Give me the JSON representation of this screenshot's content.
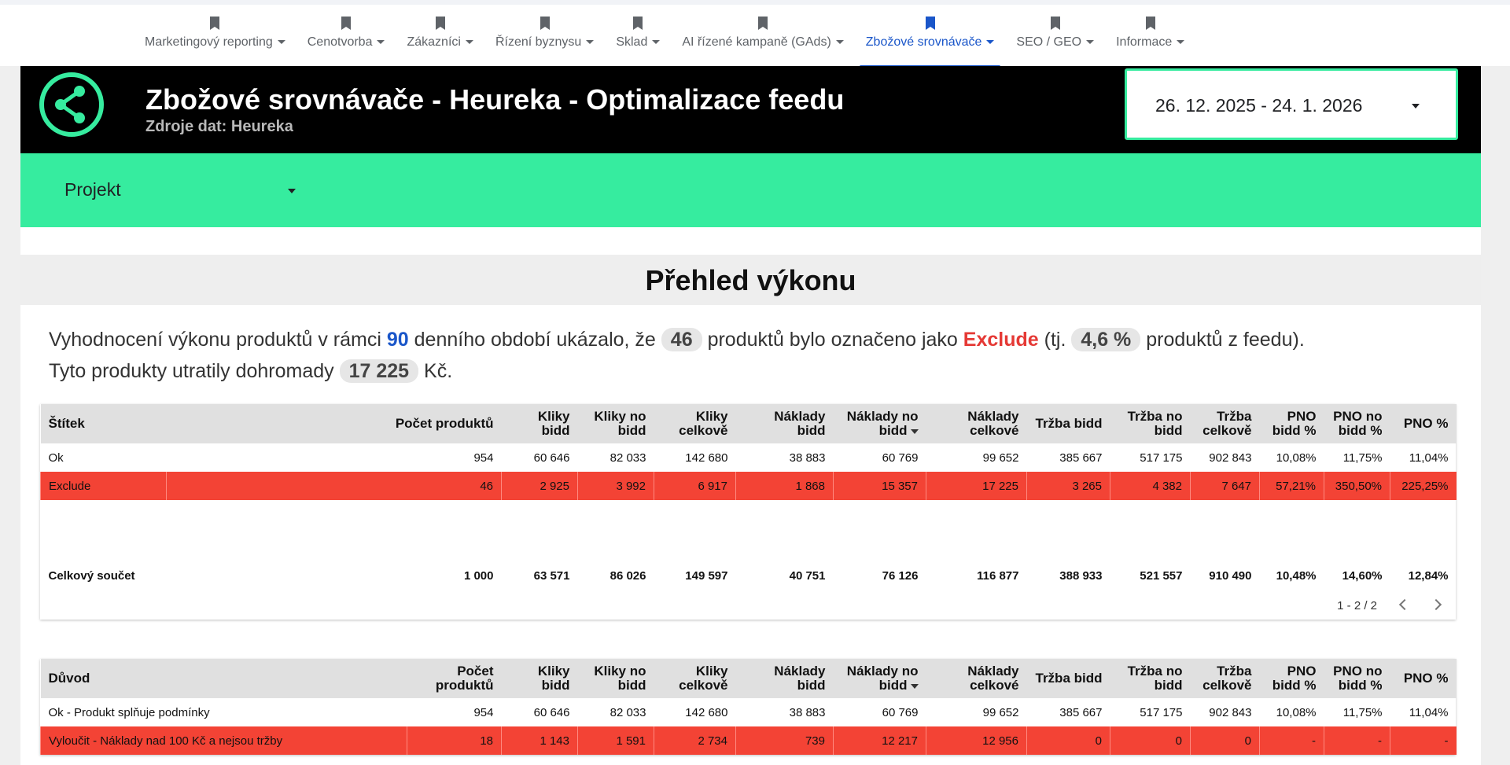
{
  "nav": {
    "items": [
      {
        "label": "Marketingový reporting",
        "active": false
      },
      {
        "label": "Cenotvorba",
        "active": false
      },
      {
        "label": "Zákazníci",
        "active": false
      },
      {
        "label": "Řízení byznysu",
        "active": false
      },
      {
        "label": "Sklad",
        "active": false
      },
      {
        "label": "AI řízené kampaně (GAds)",
        "active": false
      },
      {
        "label": "Zbožové srovnávače",
        "active": true
      },
      {
        "label": "SEO / GEO",
        "active": false
      },
      {
        "label": "Informace",
        "active": false
      }
    ]
  },
  "header": {
    "title": "Zbožové srovnávače - Heureka - Optimalizace feedu",
    "subtitle": "Zdroje dat: Heureka",
    "date_range": "26. 12. 2025 - 24. 1. 2026",
    "logo_icon": "share-icon"
  },
  "filter": {
    "project_label": "Projekt"
  },
  "section": {
    "title": "Přehled výkonu"
  },
  "summary": {
    "p1": "Vyhodnocení výkonu produktů v rámci",
    "days": "90",
    "p2": "denního období ukázalo, že",
    "count": "46",
    "p3": "produktů bylo označeno jako",
    "exclude": "Exclude",
    "p4": "(tj.",
    "percent": "4,6 %",
    "p5": "produktů z feedu).",
    "p6": "Tyto produkty utratily dohromady",
    "spend": "17 225",
    "p7": "Kč."
  },
  "colors": {
    "accent": "#36ec9f",
    "active_nav": "#1a56c9",
    "exclude_row": "#f34335",
    "header_bg": "#000000"
  },
  "table1": {
    "headers": [
      "Štítek",
      "Počet produktů",
      "Kliky bidd",
      "Kliky no bidd",
      "Kliky celkově",
      "Náklady bidd",
      "Náklady no bidd",
      "Náklady celkové",
      "Tržba bidd",
      "Tržba no bidd",
      "Tržba celkově",
      "PNO bidd %",
      "PNO no bidd %",
      "PNO %"
    ],
    "rows": [
      [
        "Ok",
        "954",
        "60 646",
        "82 033",
        "142 680",
        "38 883",
        "60 769",
        "99 652",
        "385 667",
        "517 175",
        "902 843",
        "10,08%",
        "11,75%",
        "11,04%"
      ],
      [
        "Exclude",
        "46",
        "2 925",
        "3 992",
        "6 917",
        "1 868",
        "15 357",
        "17 225",
        "3 265",
        "4 382",
        "7 647",
        "57,21%",
        "350,50%",
        "225,25%"
      ]
    ],
    "total": [
      "Celkový součet",
      "1 000",
      "63 571",
      "86 026",
      "149 597",
      "40 751",
      "76 126",
      "116 877",
      "388 933",
      "521 557",
      "910 490",
      "10,48%",
      "14,60%",
      "12,84%"
    ],
    "pager": "1 - 2 / 2"
  },
  "table2": {
    "headers": [
      "Důvod",
      "Počet produktů",
      "Kliky bidd",
      "Kliky no bidd",
      "Kliky celkově",
      "Náklady bidd",
      "Náklady no bidd",
      "Náklady celkové",
      "Tržba bidd",
      "Tržba no bidd",
      "Tržba celkově",
      "PNO bidd %",
      "PNO no bidd %",
      "PNO %"
    ],
    "rows": [
      [
        "Ok - Produkt splňuje podmínky",
        "954",
        "60 646",
        "82 033",
        "142 680",
        "38 883",
        "60 769",
        "99 652",
        "385 667",
        "517 175",
        "902 843",
        "10,08%",
        "11,75%",
        "11,04%"
      ],
      [
        "Vyloučit - Náklady nad 100 Kč a nejsou tržby",
        "18",
        "1 143",
        "1 591",
        "2 734",
        "739",
        "12 217",
        "12 956",
        "0",
        "0",
        "0",
        "-",
        "-",
        "-"
      ]
    ]
  }
}
